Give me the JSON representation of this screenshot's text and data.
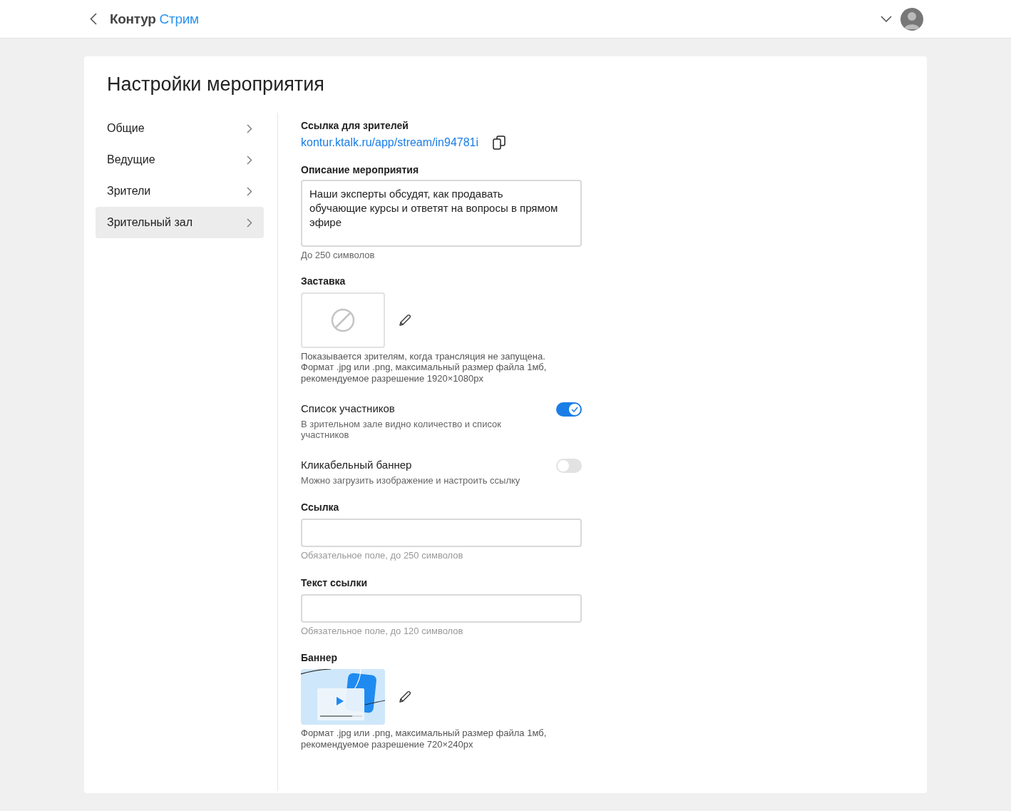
{
  "header": {
    "brand": {
      "name": "Контур",
      "product": "Стрим"
    }
  },
  "page": {
    "title": "Настройки мероприятия"
  },
  "sidebar": {
    "items": [
      {
        "label": "Общие",
        "selected": false
      },
      {
        "label": "Ведущие",
        "selected": false
      },
      {
        "label": "Зрители",
        "selected": false
      },
      {
        "label": "Зрительный зал",
        "selected": true
      }
    ]
  },
  "sections": [
    {
      "kind": "link",
      "label": "Ссылка для зрителей",
      "url": "kontur.ktalk.ru/app/stream/in94781i"
    },
    {
      "kind": "textarea",
      "label": "Описание мероприятия",
      "value": "Наши эксперты обсудят, как продавать обучающие курсы и ответят на вопросы в прямом эфире",
      "hint": "До 250 символов"
    },
    {
      "kind": "empty_image",
      "label": "Заставка",
      "hint_lines": [
        "Показывается зрителям, когда трансляция не запущена.",
        "Формат .jpg или .png, максимальный размер файла 1мб,",
        "рекомендуемое разрешение 1920×1080px"
      ]
    },
    {
      "kind": "toggle",
      "title": "Список участников",
      "description": "В зрительном зале видно количество и список участников",
      "on": true
    },
    {
      "kind": "toggle",
      "title": "Кликабельный баннер",
      "description": "Можно загрузить изображение и настроить ссылку",
      "on": false
    },
    {
      "kind": "input",
      "label": "Ссылка",
      "hint": "Обязательное поле, до 250 символов"
    },
    {
      "kind": "input",
      "label": "Текст ссылки",
      "hint": "Обязательное поле, до 120 символов"
    },
    {
      "kind": "banner_image",
      "label": "Баннер",
      "hint_lines": [
        "Формат .jpg или .png, максимальный размер файла 1мб,",
        "рекомендуемое разрешение 720×240px"
      ]
    }
  ]
}
